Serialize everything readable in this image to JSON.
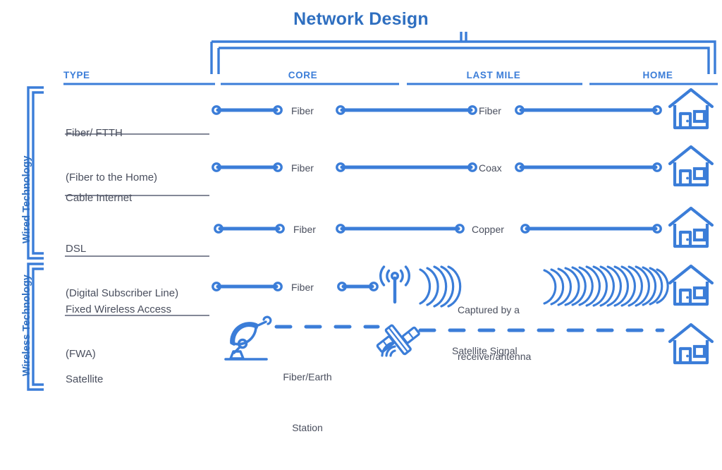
{
  "title": "Network Design",
  "colors": {
    "accent_blue": "#3b7dd8",
    "title_blue": "#2f6fc0",
    "text_gray": "#4a4f5e",
    "background": "#ffffff"
  },
  "columns": {
    "type": "TYPE",
    "core": "CORE",
    "last_mile": "LAST MILE",
    "home": "HOME"
  },
  "groups": [
    {
      "label": "Wired Technology"
    },
    {
      "label": "Wireless Technology"
    }
  ],
  "rows": [
    {
      "type_line1": "Fiber/ FTTH",
      "type_line2": "(Fiber to the Home)",
      "core_label": "Fiber",
      "last_mile_label": "Fiber",
      "home_icon": "house-icon"
    },
    {
      "type_line1": "Cable Internet",
      "type_line2": "",
      "core_label": "Fiber",
      "last_mile_label": "Coax",
      "home_icon": "house-icon"
    },
    {
      "type_line1": "DSL",
      "type_line2": "(Digital Subscriber Line)",
      "core_label": "Fiber",
      "last_mile_label": "Copper",
      "home_icon": "house-icon"
    },
    {
      "type_line1": "Fixed Wireless Access",
      "type_line2": "(FWA)",
      "core_label": "Fiber",
      "last_mile_label_line1": "Captured by a",
      "last_mile_label_line2": "receiver/antenna",
      "home_icon": "house-icon"
    },
    {
      "type_line1": "Satellite",
      "type_line2": "",
      "core_label_line1": "Fiber/Earth",
      "core_label_line2": "Station",
      "last_mile_label": "Satellite Signal",
      "home_icon": "house-icon"
    }
  ],
  "icons": {
    "connector": "cable-connector-icon",
    "house": "house-icon",
    "antenna": "antenna-tower-icon",
    "waves": "radio-waves-icon",
    "dish": "satellite-dish-icon",
    "satellite": "satellite-icon"
  }
}
